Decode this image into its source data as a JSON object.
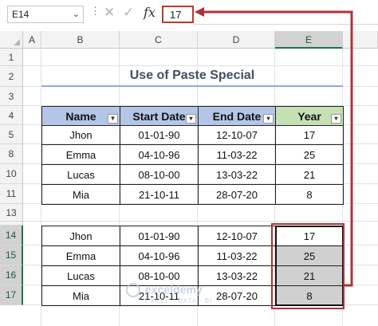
{
  "formula_bar": {
    "name_box": "E14",
    "name_box_icon": "chevron-down-icon",
    "cancel_icon": "cancel-x-icon",
    "enter_icon": "enter-check-icon",
    "fx_label": "fx",
    "formula_value": "17"
  },
  "columns": [
    "A",
    "B",
    "C",
    "D",
    "E"
  ],
  "rows": [
    "1",
    "2",
    "3",
    "4",
    "5",
    "8",
    "10",
    "11",
    "13",
    "14",
    "15",
    "16",
    "17"
  ],
  "title": "Use of Paste Special",
  "table1": {
    "headers": [
      "Name",
      "Start Date",
      "End Date",
      "Year"
    ],
    "rows": [
      [
        "Jhon",
        "01-01-90",
        "12-10-07",
        "17"
      ],
      [
        "Emma",
        "04-10-96",
        "11-03-22",
        "25"
      ],
      [
        "Lucas",
        "08-10-00",
        "13-03-22",
        "21"
      ],
      [
        "Mia",
        "21-10-11",
        "28-07-20",
        "8"
      ]
    ]
  },
  "table2": {
    "rows": [
      [
        "Jhon",
        "01-01-90",
        "12-10-07",
        "17"
      ],
      [
        "Emma",
        "04-10-96",
        "11-03-22",
        "25"
      ],
      [
        "Lucas",
        "08-10-00",
        "13-03-22",
        "21"
      ],
      [
        "Mia",
        "21-10-11",
        "28-07-20",
        "8"
      ]
    ]
  },
  "colors": {
    "header_blue": "#b4c6e7",
    "header_green": "#c6e0b4",
    "highlight_red": "#b0313b",
    "selected_gray": "#d0d0d0"
  },
  "watermark": {
    "main": "exceldemy",
    "sub": "EXCEL · DATA · BI"
  }
}
